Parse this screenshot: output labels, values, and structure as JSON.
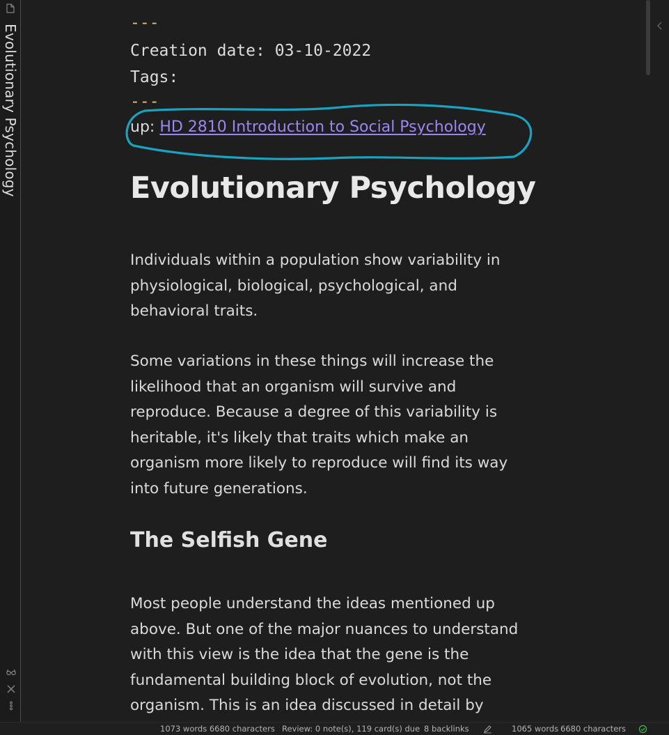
{
  "sidebar": {
    "vertical_title": "Evolutionary Psychology"
  },
  "frontmatter": {
    "open_delimiter": "---",
    "creation_label": "Creation date:",
    "creation_value": "03-10-2022",
    "tags_label": "Tags:",
    "close_delimiter": "---"
  },
  "up_link": {
    "prefix": "up:",
    "link_text": "HD 2810 Introduction to Social Psychology"
  },
  "note": {
    "title": "Evolutionary Psychology",
    "paragraph_1_lines": [
      "Individuals within a population show variability in",
      "physiological, biological, psychological, and",
      "behavioral traits."
    ],
    "paragraph_2_lines": [
      "Some variations in these things will increase the",
      "likelihood that an organism will survive and",
      "reproduce. Because a degree of this variability is",
      "heritable, it's likely that traits which make an",
      "organism more likely to reproduce will find its way",
      "into future generations."
    ],
    "subheading": "The Selfish Gene",
    "paragraph_3_lines": [
      "Most people understand the ideas mentioned up",
      "above. But one of the major nuances to understand",
      "with this view is the idea that the gene is the",
      "fundamental building block of evolution, not the",
      "organism. This is an idea discussed in detail by"
    ]
  },
  "status_bar": {
    "word_count_1": "1073 words 6680 characters",
    "review": "Review: 0 note(s), 119 card(s) due",
    "backlinks": "8 backlinks",
    "words": "1065 words",
    "characters": "6680 characters"
  },
  "colors": {
    "background": "#1e1e1e",
    "link": "#9d86f2",
    "frontmatter_delimiter": "#e5c07b",
    "annotation_circle": "#1aa3c0",
    "sync_ok": "#3fb950"
  },
  "icons": {
    "file": "file-icon",
    "glasses": "glasses-icon",
    "close": "close-icon",
    "more": "more-vertical-icon",
    "collapse": "chevron-left-icon",
    "edit": "pencil-icon",
    "sync": "check-circle-icon"
  }
}
